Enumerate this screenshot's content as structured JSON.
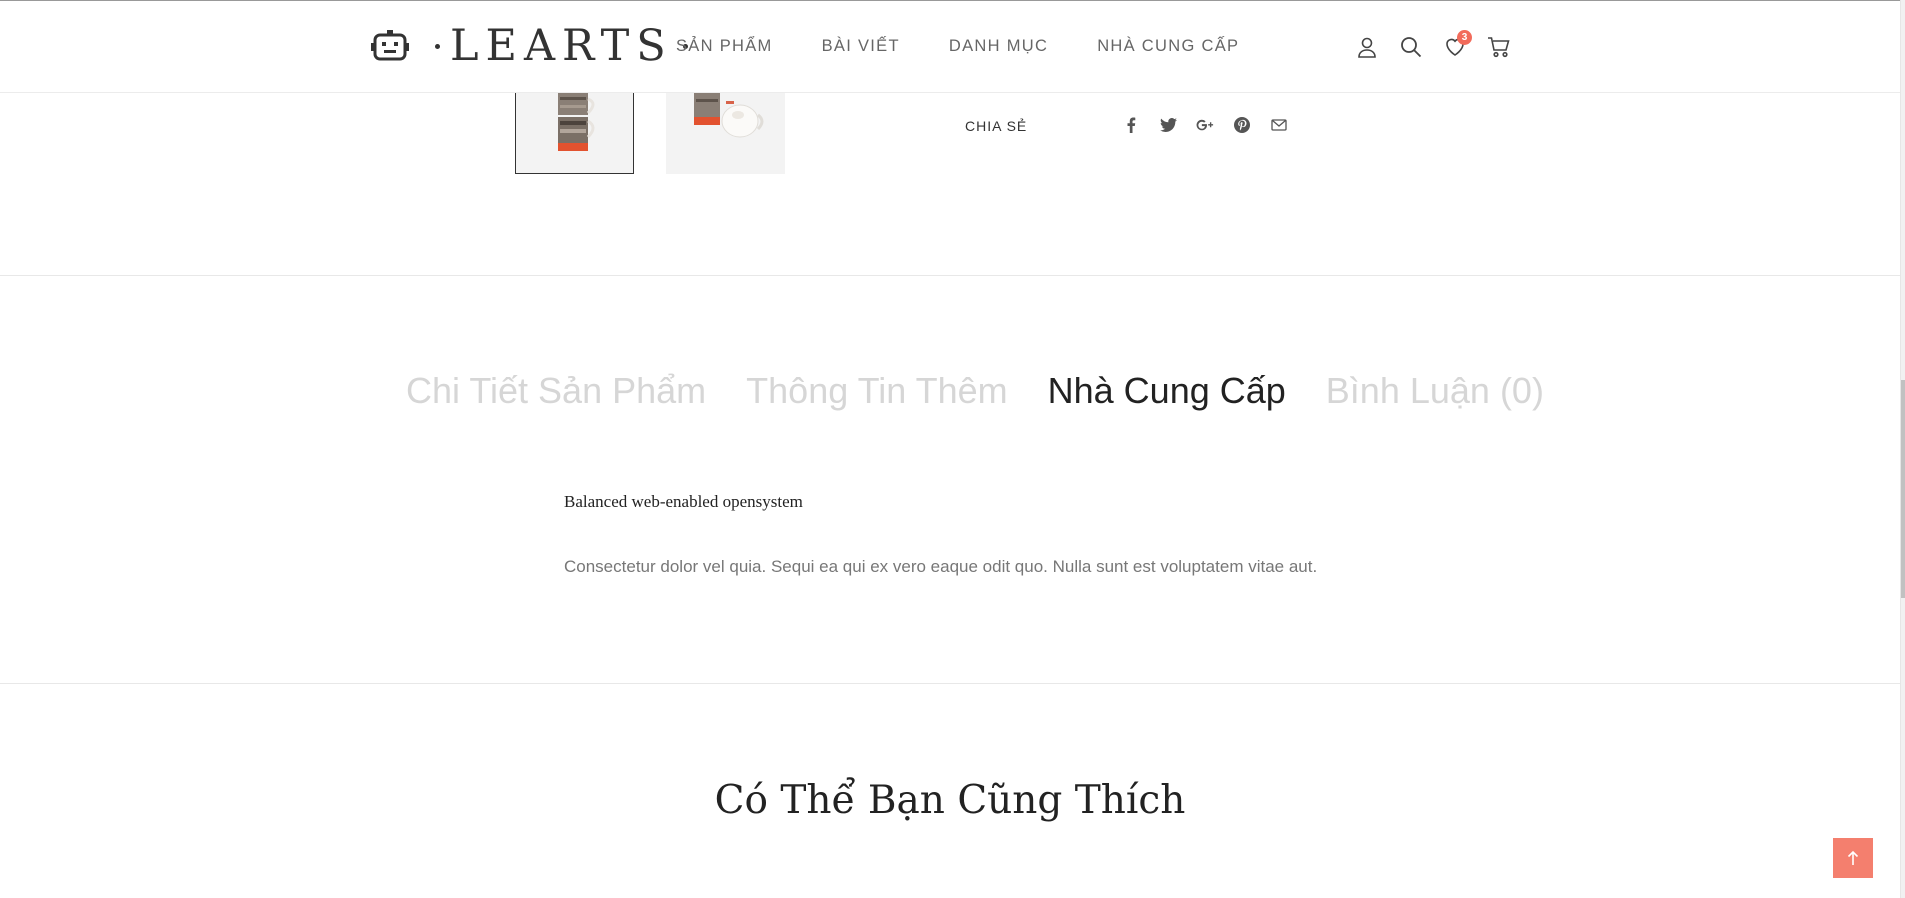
{
  "brand": {
    "logo_text": "LEARTS",
    "logo_icon": "robot-icon"
  },
  "nav": {
    "items": [
      {
        "label": "SẢN PHẨM"
      },
      {
        "label": "BÀI VIẾT"
      },
      {
        "label": "DANH MỤC"
      },
      {
        "label": "NHÀ CUNG CẤP"
      }
    ]
  },
  "header_icons": {
    "account": "user-icon",
    "search": "search-icon",
    "wishlist": "heart-icon",
    "wishlist_count": "3",
    "cart": "cart-icon"
  },
  "share": {
    "label": "CHIA SẺ",
    "networks": [
      "facebook-icon",
      "twitter-icon",
      "google-plus-icon",
      "pinterest-icon",
      "email-icon"
    ]
  },
  "tabs": {
    "items": [
      {
        "label": "Chi Tiết Sản Phẩm",
        "active": false
      },
      {
        "label": "Thông Tin Thêm",
        "active": false
      },
      {
        "label": "Nhà Cung Cấp",
        "active": true
      },
      {
        "label": "Bình Luận (0)",
        "active": false
      }
    ]
  },
  "supplier": {
    "name": "Balanced web-enabled opensystem",
    "description": "Consectetur dolor vel quia. Sequi ea qui ex vero eaque odit quo. Nulla sunt est voluptatem vitae aut."
  },
  "related": {
    "title": "Có Thể Bạn Cũng Thích"
  },
  "colors": {
    "accent": "#f47f6e",
    "badge": "#f26b5b",
    "tab_inactive": "#d6d6d6",
    "tab_active": "#222222"
  },
  "back_to_top": {
    "icon": "arrow-up-icon"
  }
}
